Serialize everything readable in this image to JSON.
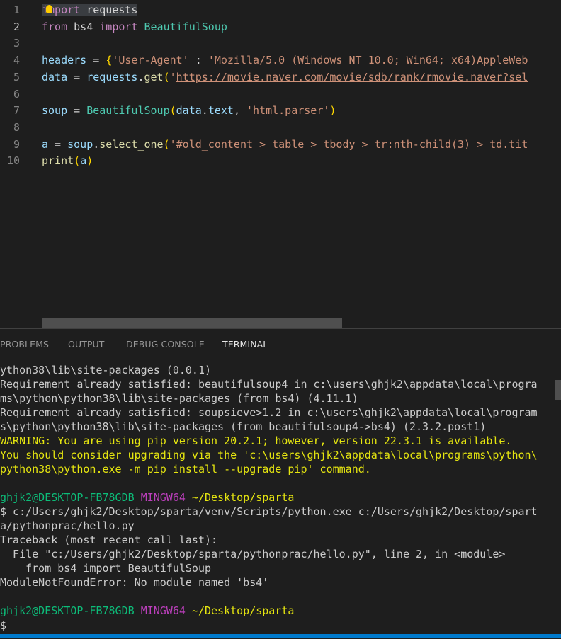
{
  "editor": {
    "lines": [
      {
        "num": "1",
        "parts": [
          {
            "t": "import",
            "c": "kw"
          },
          {
            "t": " requests",
            "c": "id"
          }
        ]
      },
      {
        "num": "2",
        "parts": [
          {
            "t": "from",
            "c": "kw"
          },
          {
            "t": " bs4 ",
            "c": "id"
          },
          {
            "t": "import",
            "c": "kw"
          },
          {
            "t": " ",
            "c": "id"
          },
          {
            "t": "BeautifulSoup",
            "c": "cls"
          }
        ]
      },
      {
        "num": "3",
        "parts": []
      },
      {
        "num": "4",
        "parts": [
          {
            "t": "headers",
            "c": "var"
          },
          {
            "t": " = ",
            "c": "id"
          },
          {
            "t": "{",
            "c": "br"
          },
          {
            "t": "'User-Agent'",
            "c": "str"
          },
          {
            "t": " : ",
            "c": "id"
          },
          {
            "t": "'Mozilla/5.0 (Windows NT 10.0; Win64; x64)AppleWeb",
            "c": "str"
          }
        ]
      },
      {
        "num": "5",
        "parts": [
          {
            "t": "data",
            "c": "var"
          },
          {
            "t": " = ",
            "c": "id"
          },
          {
            "t": "requests",
            "c": "var"
          },
          {
            "t": ".",
            "c": "id"
          },
          {
            "t": "get",
            "c": "fn"
          },
          {
            "t": "(",
            "c": "br"
          },
          {
            "t": "'",
            "c": "str"
          },
          {
            "t": "https://movie.naver.com/movie/sdb/rank/rmovie.naver?sel",
            "c": "url"
          }
        ]
      },
      {
        "num": "6",
        "parts": []
      },
      {
        "num": "7",
        "parts": [
          {
            "t": "soup",
            "c": "var"
          },
          {
            "t": " = ",
            "c": "id"
          },
          {
            "t": "BeautifulSoup",
            "c": "cls"
          },
          {
            "t": "(",
            "c": "br"
          },
          {
            "t": "data",
            "c": "var"
          },
          {
            "t": ".",
            "c": "id"
          },
          {
            "t": "text",
            "c": "var"
          },
          {
            "t": ", ",
            "c": "id"
          },
          {
            "t": "'html.parser'",
            "c": "str"
          },
          {
            "t": ")",
            "c": "br"
          }
        ]
      },
      {
        "num": "8",
        "parts": []
      },
      {
        "num": "9",
        "parts": [
          {
            "t": "a",
            "c": "var"
          },
          {
            "t": " = ",
            "c": "id"
          },
          {
            "t": "soup",
            "c": "var"
          },
          {
            "t": ".",
            "c": "id"
          },
          {
            "t": "select_one",
            "c": "fn"
          },
          {
            "t": "(",
            "c": "br"
          },
          {
            "t": "'#old_content > table > tbody > tr:nth-child(3) > td.tit",
            "c": "str"
          }
        ]
      },
      {
        "num": "10",
        "parts": [
          {
            "t": "print",
            "c": "fn"
          },
          {
            "t": "(",
            "c": "br"
          },
          {
            "t": "a",
            "c": "var"
          },
          {
            "t": ")",
            "c": "br"
          }
        ]
      }
    ]
  },
  "panel": {
    "tabs": [
      "PROBLEMS",
      "OUTPUT",
      "DEBUG CONSOLE",
      "TERMINAL"
    ],
    "active_tab": "TERMINAL"
  },
  "terminal": {
    "lines": [
      {
        "parts": [
          {
            "t": "ython38\\lib\\site-packages (0.0.1)",
            "c": ""
          }
        ]
      },
      {
        "parts": [
          {
            "t": "Requirement already satisfied: beautifulsoup4 in c:\\users\\ghjk2\\appdata\\local\\progra",
            "c": ""
          }
        ]
      },
      {
        "parts": [
          {
            "t": "ms\\python\\python38\\lib\\site-packages (from bs4) (4.11.1)",
            "c": ""
          }
        ]
      },
      {
        "parts": [
          {
            "t": "Requirement already satisfied: soupsieve>1.2 in c:\\users\\ghjk2\\appdata\\local\\program",
            "c": ""
          }
        ]
      },
      {
        "parts": [
          {
            "t": "s\\python\\python38\\lib\\site-packages (from beautifulsoup4->bs4) (2.3.2.post1)",
            "c": ""
          }
        ]
      },
      {
        "parts": [
          {
            "t": "WARNING: You are using pip version 20.2.1; however, version 22.3.1 is available.",
            "c": "warn"
          }
        ]
      },
      {
        "parts": [
          {
            "t": "You should consider upgrading via the 'c:\\users\\ghjk2\\appdata\\local\\programs\\python\\",
            "c": "warn"
          }
        ]
      },
      {
        "parts": [
          {
            "t": "python38\\python.exe -m pip install --upgrade pip' command.",
            "c": "warn"
          }
        ]
      },
      {
        "parts": []
      },
      {
        "parts": [
          {
            "t": "ghjk2@DESKTOP-FB78GDB",
            "c": "green"
          },
          {
            "t": " ",
            "c": ""
          },
          {
            "t": "MINGW64",
            "c": "magenta"
          },
          {
            "t": " ",
            "c": ""
          },
          {
            "t": "~/Desktop/sparta",
            "c": "yellow"
          }
        ]
      },
      {
        "parts": [
          {
            "t": "$ c:/Users/ghjk2/Desktop/sparta/venv/Scripts/python.exe c:/Users/ghjk2/Desktop/spart",
            "c": ""
          }
        ]
      },
      {
        "parts": [
          {
            "t": "a/pythonprac/hello.py",
            "c": ""
          }
        ]
      },
      {
        "parts": [
          {
            "t": "Traceback (most recent call last):",
            "c": ""
          }
        ]
      },
      {
        "parts": [
          {
            "t": "  File \"c:/Users/ghjk2/Desktop/sparta/pythonprac/hello.py\", line 2, in <module>",
            "c": ""
          }
        ]
      },
      {
        "parts": [
          {
            "t": "    from bs4 import BeautifulSoup",
            "c": ""
          }
        ]
      },
      {
        "parts": [
          {
            "t": "ModuleNotFoundError: No module named 'bs4'",
            "c": ""
          }
        ]
      },
      {
        "parts": []
      },
      {
        "parts": [
          {
            "t": "ghjk2@DESKTOP-FB78GDB",
            "c": "green"
          },
          {
            "t": " ",
            "c": ""
          },
          {
            "t": "MINGW64",
            "c": "magenta"
          },
          {
            "t": " ",
            "c": ""
          },
          {
            "t": "~/Desktop/sparta",
            "c": "yellow"
          }
        ]
      },
      {
        "parts": [
          {
            "t": "$ ",
            "c": ""
          }
        ],
        "cursor": true
      }
    ]
  }
}
